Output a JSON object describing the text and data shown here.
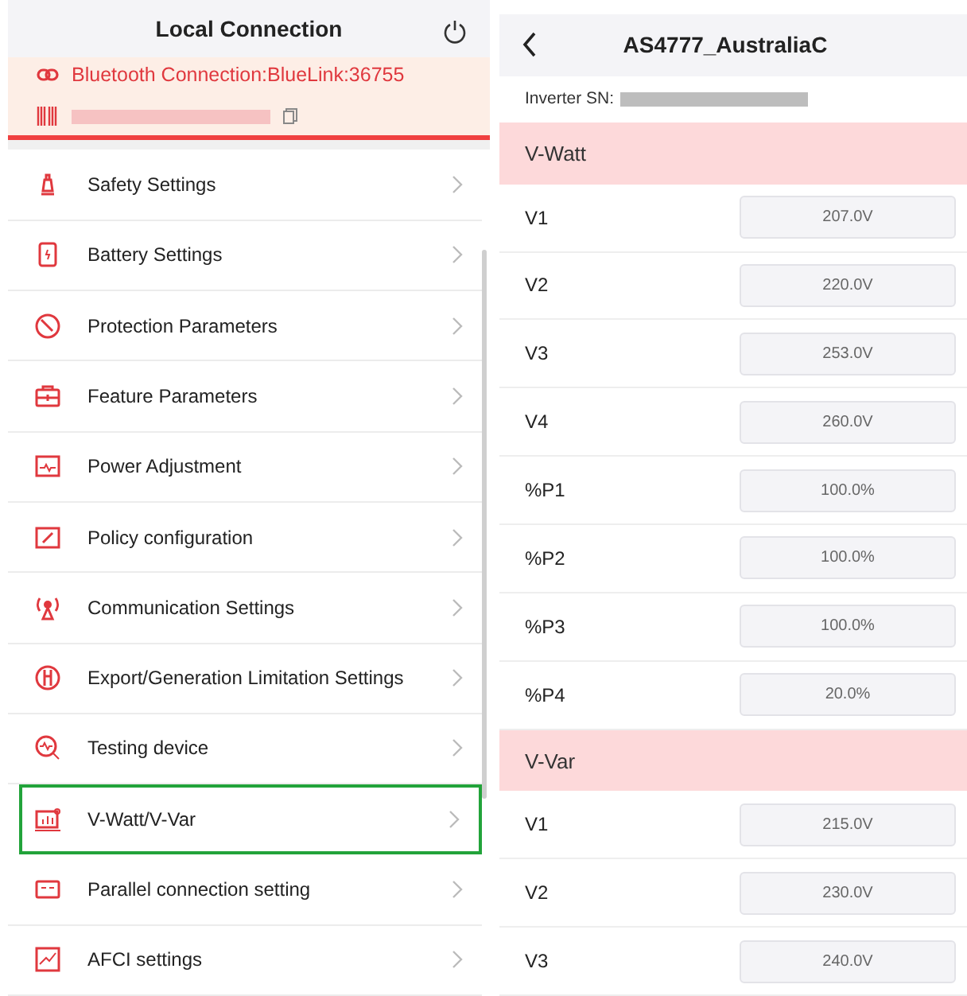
{
  "left": {
    "title": "Local Connection",
    "connection": "Bluetooth Connection:BlueLink:36755",
    "items": [
      {
        "label": "Safety Settings",
        "highlighted": false
      },
      {
        "label": "Battery Settings",
        "highlighted": false
      },
      {
        "label": "Protection Parameters",
        "highlighted": false
      },
      {
        "label": "Feature Parameters",
        "highlighted": false
      },
      {
        "label": "Power Adjustment",
        "highlighted": false
      },
      {
        "label": "Policy configuration",
        "highlighted": false
      },
      {
        "label": "Communication Settings",
        "highlighted": false
      },
      {
        "label": "Export/Generation Limitation Settings",
        "highlighted": false
      },
      {
        "label": "Testing device",
        "highlighted": false
      },
      {
        "label": "V-Watt/V-Var",
        "highlighted": true
      },
      {
        "label": "Parallel connection setting",
        "highlighted": false
      },
      {
        "label": "AFCI settings",
        "highlighted": false
      }
    ]
  },
  "right": {
    "title": "AS4777_AustraliaC",
    "sn_label": "Inverter SN:",
    "sections": [
      {
        "title": "V-Watt",
        "fields": [
          {
            "label": "V1",
            "value": "207.0V"
          },
          {
            "label": "V2",
            "value": "220.0V"
          },
          {
            "label": "V3",
            "value": "253.0V"
          },
          {
            "label": "V4",
            "value": "260.0V"
          },
          {
            "label": "%P1",
            "value": "100.0%"
          },
          {
            "label": "%P2",
            "value": "100.0%"
          },
          {
            "label": "%P3",
            "value": "100.0%"
          },
          {
            "label": "%P4",
            "value": "20.0%"
          }
        ]
      },
      {
        "title": "V-Var",
        "fields": [
          {
            "label": "V1",
            "value": "215.0V"
          },
          {
            "label": "V2",
            "value": "230.0V"
          },
          {
            "label": "V3",
            "value": "240.0V"
          }
        ]
      }
    ]
  }
}
